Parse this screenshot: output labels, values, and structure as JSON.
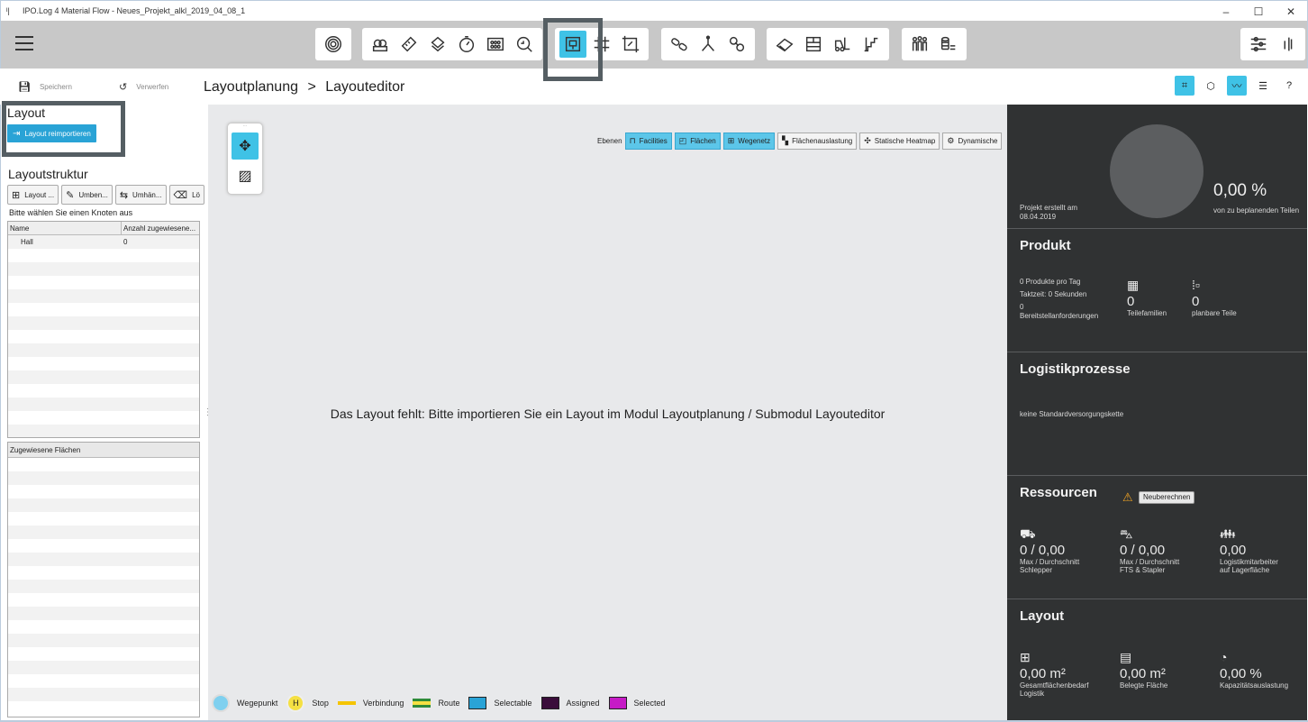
{
  "window": {
    "title": "IPO.Log 4 Material Flow - Neues_Projekt_alkl_2019_04_08_1",
    "controls": [
      "–",
      "☐",
      "✕"
    ]
  },
  "toolbar": {
    "active_tool": "layout-editor",
    "icons": [
      "radar-icon",
      "products-icon",
      "ruler-icon",
      "parts-icon",
      "clock-icon",
      "components-icon",
      "analysis-icon",
      "layout-editor-icon",
      "grid-icon",
      "area-icon",
      "chain-icon",
      "branch-icon",
      "links-icon",
      "conveyor-icon",
      "shelf-icon",
      "forklift-icon",
      "stairs-icon",
      "workers-icon",
      "coins-icon",
      "settings-sliders-icon",
      "panel-toggle-icon"
    ]
  },
  "actions": {
    "save": "Speichern",
    "discard": "Verwerfen"
  },
  "breadcrumb": {
    "module": "Layoutplanung",
    "separator": ">",
    "submodule": "Layouteditor"
  },
  "left": {
    "layout_heading": "Layout",
    "reimport_button": "Layout reimportieren",
    "structure_heading": "Layoutstruktur",
    "structure_buttons": [
      "Layout ...",
      "Umben...",
      "Umhän...",
      "Lö"
    ],
    "select_hint": "Bitte wählen Sie einen Knoten aus",
    "tree_columns": [
      "Name",
      "Anzahl zugewiesene..."
    ],
    "tree_rows": [
      {
        "name": "Hall",
        "count": "0"
      }
    ],
    "assigned_heading": "Zugewiesene Flächen"
  },
  "canvas": {
    "layers_label": "Ebenen",
    "layers": [
      {
        "label": "Facilities",
        "on": true
      },
      {
        "label": "Flächen",
        "on": true
      },
      {
        "label": "Wegenetz",
        "on": true
      },
      {
        "label": "Flächenauslastung",
        "on": false
      },
      {
        "label": "Statische Heatmap",
        "on": false
      },
      {
        "label": "Dynamische",
        "on": false
      }
    ],
    "missing_message": "Das Layout fehlt: Bitte importieren Sie ein Layout im Modul Layoutplanung / Submodul Layouteditor",
    "legend": {
      "waypoint": "Wegepunkt",
      "stop": "Stop",
      "stop_symbol": "H",
      "connection": "Verbindung",
      "route": "Route",
      "selectable": "Selectable",
      "assigned": "Assigned",
      "selected": "Selected"
    },
    "legend_colors": {
      "waypoint": "#7fd0ef",
      "stop": "#f5e043",
      "connection": "#f5c400",
      "route_top": "#2e8b3a",
      "route_bottom": "#f5e043",
      "selectable": "#29a3d6",
      "assigned": "#3a0d3a",
      "selected": "#c61bc6"
    }
  },
  "summary": {
    "created_label": "Projekt erstellt am",
    "created_date": "08.04.2019",
    "percent": "0,00 %",
    "percent_label": "von zu beplanenden Teilen",
    "product": {
      "title": "Produkt",
      "per_day": "0 Produkte pro Tag",
      "takt": "Taktzeit: 0 Sekunden",
      "requests_value": "0",
      "requests_label": "Bereitstellanforderungen",
      "families_value": "0",
      "families_label": "Teilefamilien",
      "parts_value": "0",
      "parts_label": "planbare Teile"
    },
    "logistics": {
      "title": "Logistikprozesse",
      "text": "keine Standardversorgungskette"
    },
    "resources": {
      "title": "Ressourcen",
      "recalc_button": "Neuberechnen",
      "tugger_value": "0 / 0,00",
      "tugger_label1": "Max / Durchschnitt",
      "tugger_label2": "Schlepper",
      "fts_value": "0 / 0,00",
      "fts_label1": "Max / Durchschnitt",
      "fts_label2": "FTS & Stapler",
      "workers_value": "0,00",
      "workers_label1": "Logistikmitarbeiter",
      "workers_label2": "auf Lagerfläche"
    },
    "layout": {
      "title": "Layout",
      "total_value": "0,00 m²",
      "total_label1": "Gesamtflächenbedarf",
      "total_label2": "Logistik",
      "occupied_value": "0,00 m²",
      "occupied_label": "Belegte Fläche",
      "capacity_value": "0,00 %",
      "capacity_label": "Kapazitätsauslastung"
    }
  }
}
